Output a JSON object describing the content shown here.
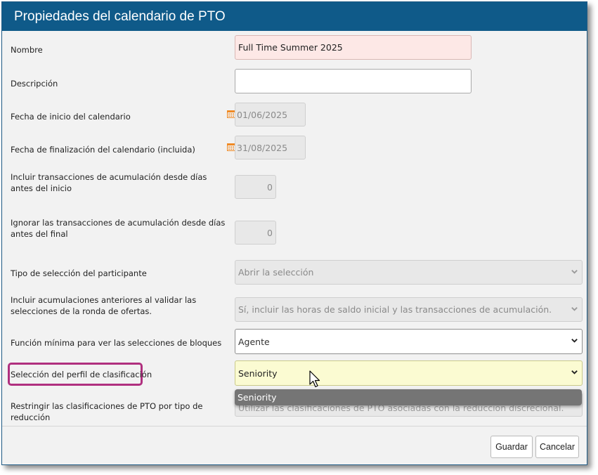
{
  "dialog": {
    "title": "Propiedades del calendario de PTO"
  },
  "form": {
    "nombre": {
      "label": "Nombre",
      "value": "Full Time Summer 2025"
    },
    "descripcion": {
      "label": "Descripción",
      "value": ""
    },
    "fecha_inicio": {
      "label": "Fecha de inicio del calendario",
      "value": "01/06/2025"
    },
    "fecha_fin": {
      "label": "Fecha de finalización del calendario (incluida)",
      "value": "31/08/2025"
    },
    "incluir_transacciones": {
      "label": "Incluir transacciones de acumulación desde días antes del inicio",
      "value": "0"
    },
    "ignorar_transacciones": {
      "label": "Ignorar las transacciones de acumulación desde días antes del final",
      "value": "0"
    },
    "tipo_seleccion": {
      "label": "Tipo de selección del participante",
      "value": "Abrir la selección"
    },
    "incluir_acumulaciones": {
      "label": "Incluir acumulaciones anteriores al validar las selecciones de la ronda de ofertas.",
      "value": "Sí, incluir las horas de saldo inicial y las transacciones de acumulación."
    },
    "funcion_minima": {
      "label": "Función mínima para ver las selecciones de bloques",
      "value": "Agente"
    },
    "perfil_clasificacion": {
      "label": "Selección del perfil de clasificación",
      "value": "Seniority",
      "options": [
        "Seniority"
      ]
    },
    "restringir": {
      "label": "Restringir las clasificaciones de PTO por tipo de reducción",
      "value": "Utilizar las clasificaciones de PTO asociadas con la reducción discrecional."
    }
  },
  "footer": {
    "save_label": "Guardar",
    "cancel_label": "Cancelar"
  },
  "colors": {
    "title_bar": "#0f5a89",
    "highlight": "#b0307f",
    "required_field": "#fde8e6",
    "active_field": "#fbfbd2",
    "calendar_icon": "#f08a24"
  }
}
